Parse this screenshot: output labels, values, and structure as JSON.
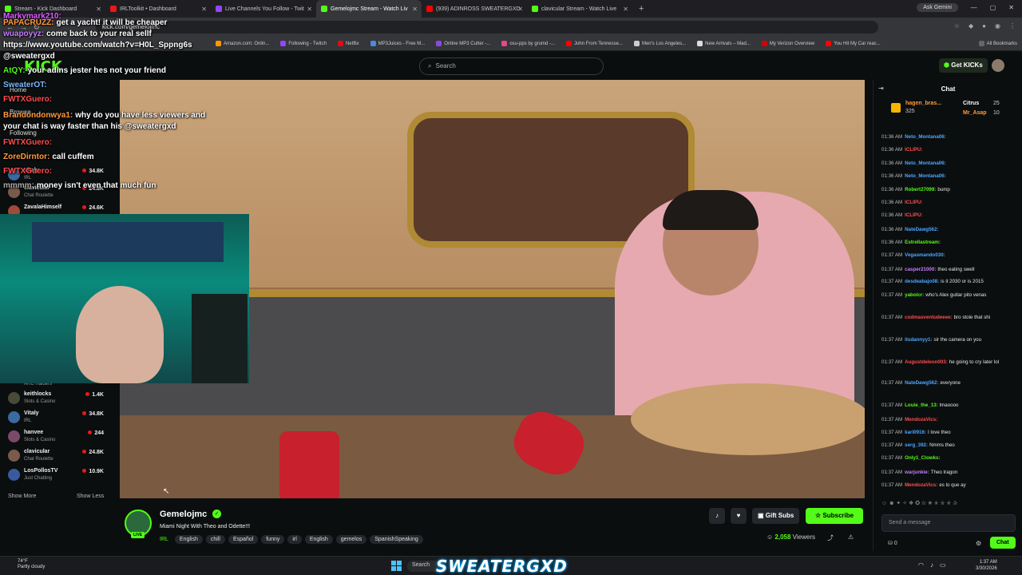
{
  "browser": {
    "tabs": [
      {
        "label": "Stream - Kick Dashboard",
        "color": "#53fc18"
      },
      {
        "label": "IRLToolkit • Dashboard",
        "color": "#e91916"
      },
      {
        "label": "Live Channels You Follow - Twit",
        "color": "#9147ff"
      },
      {
        "label": "Gemelojmc Stream - Watch Liv",
        "color": "#53fc18"
      },
      {
        "label": "(939) ADINROSS SWEATERGXD",
        "color": "#ff0000"
      },
      {
        "label": "clavicular Stream - Watch Live",
        "color": "#53fc18"
      }
    ],
    "gemini": "Ask Gemini",
    "url": "kick.com/gemelojmc",
    "bookmarks": [
      "Amazon.com: Onlin...",
      "Following - Twitch",
      "Netflix",
      "MP3Juices - Free M...",
      "Online MP3 Cutter -...",
      "osu-pps by grumd -...",
      "John From Tennesse...",
      "Men's Los Angeles...",
      "New Arrivals – Mad...",
      "My Verizon Overview",
      "You Hit My Car reac..."
    ],
    "all_bookmarks": "All Bookmarks"
  },
  "kick": {
    "search_placeholder": "Search",
    "get_kicks": "Get KICKs"
  },
  "overlay_chat": [
    {
      "user": "Markymark210:",
      "text": "",
      "color": "#e05cff"
    },
    {
      "user": "PAPACRUZZ:",
      "text": "get a yacht! it will be cheaper",
      "color": "#ff9a3c"
    },
    {
      "user": "wuapoyyz:",
      "text": "come back to your real sellf",
      "color": "#c77dff"
    },
    {
      "user": "",
      "text": "https://www.youtube.com/watch?v=H0L_Sppng6s",
      "color": "#fff"
    },
    {
      "user": "",
      "text": "@sweatergxd",
      "color": "#fff"
    },
    {
      "user": "AtQY:",
      "text": "your adins jester hes not your friend",
      "color": "#53fc18"
    },
    {
      "user": "SweaterOT:",
      "text": "",
      "color": "#7ab8ff"
    },
    {
      "user": "FWTXGuero:",
      "text": "",
      "color": "#ff4d4d"
    },
    {
      "user": "Brandondonwya1:",
      "text": "why do you have less viewers and",
      "color": "#ff9a3c"
    },
    {
      "user": "",
      "text": "your chat is way faster than his @sweatergxd",
      "color": "#fff"
    },
    {
      "user": "FWTXGuero:",
      "text": "",
      "color": "#ff4d4d"
    },
    {
      "user": "ZoreDirntor:",
      "text": "call cuffem",
      "color": "#ff9a3c"
    },
    {
      "user": "FWTXGuero:",
      "text": "",
      "color": "#ff4d4d"
    },
    {
      "user": "mmmm:",
      "text": "money isn't even that much fun",
      "color": "#aaa"
    }
  ],
  "sidebar": {
    "home": "Home",
    "browse": "Browse",
    "following": "Following",
    "channels_top": [
      {
        "name": "Vitaly",
        "category": "IRL",
        "viewers": "34.8K",
        "color": "#3a6aa0"
      },
      {
        "name": "clavicular",
        "category": "Chat Roulette",
        "viewers": "24.8K",
        "color": "#7a5a4a"
      },
      {
        "name": "ZavalaHimself",
        "category": "",
        "viewers": "24.6K",
        "color": "#a04a3a"
      }
    ],
    "channels_bottom": [
      {
        "name": "",
        "category": "ARC Raiders",
        "viewers": "",
        "color": "#333"
      },
      {
        "name": "keithlocks",
        "category": "Slots & Casino",
        "viewers": "1.4K",
        "color": "#4a4a3a"
      },
      {
        "name": "Vitaly",
        "category": "IRL",
        "viewers": "34.8K",
        "color": "#3a6aa0"
      },
      {
        "name": "hanvee",
        "category": "Slots & Casino",
        "viewers": "244",
        "color": "#7a4a6a"
      },
      {
        "name": "clavicular",
        "category": "Chat Roulette",
        "viewers": "24.8K",
        "color": "#7a5a4a"
      },
      {
        "name": "LosPollosTV",
        "category": "Just Chatting",
        "viewers": "10.9K",
        "color": "#3a5aa0"
      }
    ],
    "show_more": "Show More",
    "show_less": "Show Less"
  },
  "stream": {
    "channel": "Gemelojmc",
    "title": "Miami Night With Theo and Odette!!!",
    "category": "IRL",
    "tags": [
      "English",
      "chill",
      "Español",
      "funny",
      "irl",
      "English",
      "gemelos",
      "SpanishSpeaking"
    ],
    "live": "LIVE",
    "gift_subs": "Gift Subs",
    "subscribe": "Subscribe",
    "viewers": "2,058",
    "viewers_label": "Viewers"
  },
  "chat": {
    "header": "Chat",
    "leaderboard": [
      {
        "name": "hagen_bras...",
        "value": "325",
        "color": "#ff9a3c"
      },
      {
        "name": "Citrus",
        "value": "25",
        "color": "#fff"
      },
      {
        "name": "Mr_Asap",
        "value": "10",
        "color": "#ff9a3c"
      }
    ],
    "messages": [
      {
        "time": "01:36 AM",
        "user": "Neto_Montana06:",
        "text": "",
        "color": "#4da6ff"
      },
      {
        "time": "01:36 AM",
        "user": "ICLIPU:",
        "text": "",
        "color": "#ff4d4d"
      },
      {
        "time": "01:36 AM",
        "user": "Neto_Montana06:",
        "text": "",
        "color": "#4da6ff"
      },
      {
        "time": "01:36 AM",
        "user": "Neto_Montana06:",
        "text": "",
        "color": "#4da6ff"
      },
      {
        "time": "01:36 AM",
        "user": "Robert27099:",
        "text": "bump",
        "color": "#53fc18"
      },
      {
        "time": "01:36 AM",
        "user": "ICLIPU:",
        "text": "",
        "color": "#ff4d4d"
      },
      {
        "time": "01:36 AM",
        "user": "ICLIPU:",
        "text": "",
        "color": "#ff4d4d"
      },
      {
        "time": "01:36 AM",
        "user": "NateDawg562:",
        "text": "",
        "color": "#4da6ff"
      },
      {
        "time": "01:36 AM",
        "user": "Estrellastream:",
        "text": "",
        "color": "#53fc18"
      },
      {
        "time": "01:37 AM",
        "user": "Vegasmando030:",
        "text": "",
        "color": "#4da6ff"
      },
      {
        "time": "01:37 AM",
        "user": "casper21000:",
        "text": "theo eating swell",
        "color": "#c77dff"
      },
      {
        "time": "01:37 AM",
        "user": "desdeabajo08:",
        "text": "is it 2030 or is 2015",
        "color": "#4da6ff"
      },
      {
        "time": "01:37 AM",
        "user": "yaboicr:",
        "text": "who's Alex guitar pito venas",
        "color": "#53fc18"
      },
      {
        "time": "01:37 AM",
        "user": "codmasventudeeee:",
        "text": "bro stole that shi",
        "color": "#ff4d4d"
      },
      {
        "time": "01:37 AM",
        "user": "itsdannyy1:",
        "text": "sir the camera on you",
        "color": "#4da6ff"
      },
      {
        "time": "01:37 AM",
        "user": "Augustdeleon003:",
        "text": "he going to cry later lol",
        "color": "#ff4d4d"
      },
      {
        "time": "01:37 AM",
        "user": "NateDawg562:",
        "text": "everyone",
        "color": "#4da6ff"
      },
      {
        "time": "01:37 AM",
        "user": "Louie_the_13:",
        "text": "lmaoooo",
        "color": "#53fc18"
      },
      {
        "time": "01:37 AM",
        "user": "MendozaVics:",
        "text": "",
        "color": "#ff4d4d"
      },
      {
        "time": "01:37 AM",
        "user": "kari0916:",
        "text": "I love theo",
        "color": "#4da6ff"
      },
      {
        "time": "01:37 AM",
        "user": "serg_392:",
        "text": "Nmms theo",
        "color": "#4da6ff"
      },
      {
        "time": "01:37 AM",
        "user": "Only1_Clowks:",
        "text": "",
        "color": "#53fc18"
      },
      {
        "time": "01:37 AM",
        "user": "warjunkie:",
        "text": "Theo tragon",
        "color": "#c77dff"
      },
      {
        "time": "01:37 AM",
        "user": "MendozaVics:",
        "text": "es lo que ay",
        "color": "#ff4d4d"
      }
    ],
    "send_placeholder": "Send a message",
    "kick_count": "0",
    "chat_button": "Chat"
  },
  "taskbar": {
    "temp": "74°F",
    "weather": "Partly cloudy",
    "search": "Search",
    "overlay_name": "SWEATERGXD",
    "time": "1:37 AM",
    "date": "3/30/2026"
  }
}
